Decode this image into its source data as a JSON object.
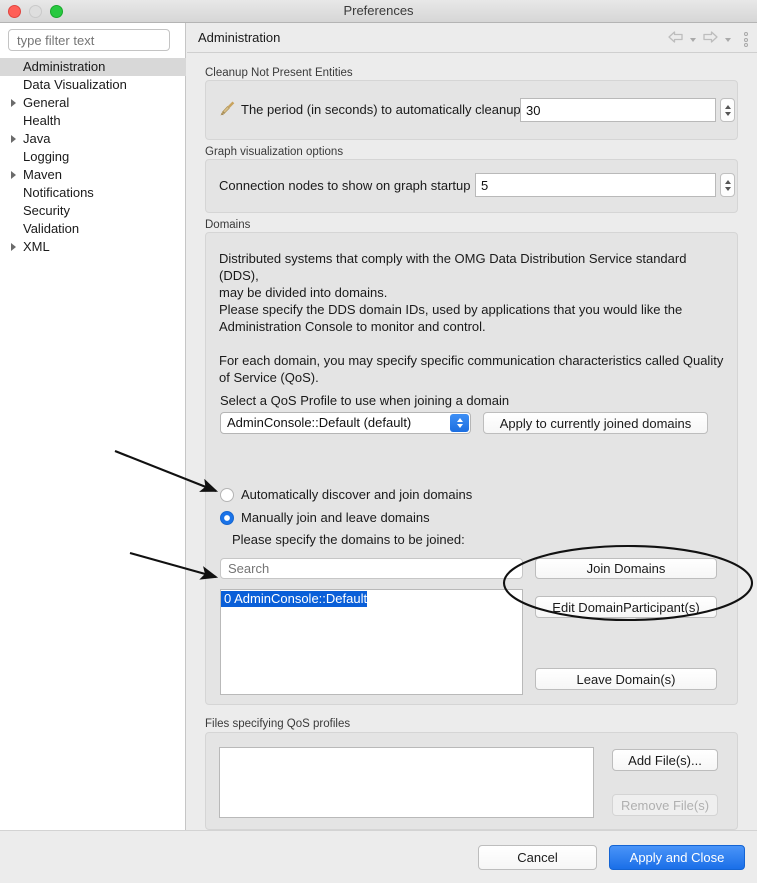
{
  "window": {
    "title": "Preferences",
    "traffic_lights": [
      "close-red",
      "minimize-gray",
      "zoom-green"
    ]
  },
  "sidebar": {
    "filter_placeholder": "type filter text",
    "items": [
      {
        "label": "Administration",
        "expandable": false,
        "selected": true
      },
      {
        "label": "Data Visualization",
        "expandable": false,
        "selected": false
      },
      {
        "label": "General",
        "expandable": true,
        "selected": false
      },
      {
        "label": "Health",
        "expandable": false,
        "selected": false
      },
      {
        "label": "Java",
        "expandable": true,
        "selected": false
      },
      {
        "label": "Logging",
        "expandable": false,
        "selected": false
      },
      {
        "label": "Maven",
        "expandable": true,
        "selected": false
      },
      {
        "label": "Notifications",
        "expandable": false,
        "selected": false
      },
      {
        "label": "Security",
        "expandable": false,
        "selected": false
      },
      {
        "label": "Validation",
        "expandable": false,
        "selected": false
      },
      {
        "label": "XML",
        "expandable": true,
        "selected": false
      }
    ]
  },
  "pane": {
    "title": "Administration",
    "nav": {
      "back_icon": "back-arrow-icon",
      "forward_icon": "forward-arrow-icon",
      "menu_icon": "vertical-dots-icon"
    }
  },
  "cleanup": {
    "group_label": "Cleanup Not Present Entities",
    "icon": "broom-icon",
    "label": "The period (in seconds) to automatically cleanup",
    "value": "30"
  },
  "graph": {
    "group_label": "Graph visualization options",
    "label": "Connection nodes to show on graph startup",
    "value": "5"
  },
  "domains": {
    "group_label": "Domains",
    "description": "Distributed systems that comply with the OMG Data Distribution Service standard (DDS),\nmay be divided into domains.\nPlease specify the DDS domain IDs, used by applications that you would like the\nAdministration Console to monitor and control.\n\nFor each domain, you may specify specific communication characteristics called Quality\nof Service (QoS).",
    "qos_select_label": "Select a QoS Profile to use when joining a domain",
    "qos_selected": "AdminConsole::Default (default)",
    "apply_button": "Apply to currently joined domains",
    "radio_auto": "Automatically discover and join domains",
    "radio_manual": "Manually join and leave domains",
    "radio_selected": "manual",
    "specify_label": "Please specify the domains to be joined:",
    "search_placeholder": "Search",
    "join_button": "Join Domains",
    "edit_button": "Edit DomainParticipant(s)",
    "leave_button": "Leave Domain(s)",
    "list_items": [
      {
        "label": "0 AdminConsole::Default",
        "selected": true
      }
    ]
  },
  "files": {
    "group_label": "Files specifying QoS profiles",
    "list_items": [],
    "add_button": "Add File(s)...",
    "remove_button": "Remove File(s)",
    "remove_disabled": true
  },
  "footer": {
    "cancel_button": "Cancel",
    "apply_close_button": "Apply and Close"
  },
  "annotations": {
    "arrow_1": "arrow pointing to Manually join and leave domains radio",
    "arrow_2": "arrow pointing to 0 AdminConsole::Default list item",
    "ellipse_1": "ellipse circling Edit DomainParticipant(s) button"
  },
  "colors": {
    "accent": "#1a73e8",
    "primary_button": "#1a6fe8",
    "selection": "#0a5fd8",
    "window_bg": "#ececec",
    "group_bg": "#e4e4e4"
  }
}
